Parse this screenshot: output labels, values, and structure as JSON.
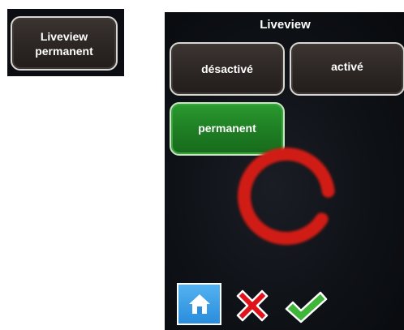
{
  "thumbnail": {
    "line1": "Liveview",
    "line2": "permanent"
  },
  "dialog": {
    "title": "Liveview",
    "options": {
      "off": "désactivé",
      "on": "activé",
      "permanent": "permanent"
    },
    "selected": "permanent"
  },
  "toolbar": {
    "home_icon": "home-icon",
    "cancel_icon": "close-icon",
    "confirm_icon": "checkmark-icon"
  },
  "colors": {
    "selected_option": "#1f7f24",
    "spinner": "#d11a12",
    "home_button": "#2a8ddd",
    "cancel": "#e0131a",
    "confirm": "#3fb53a"
  }
}
